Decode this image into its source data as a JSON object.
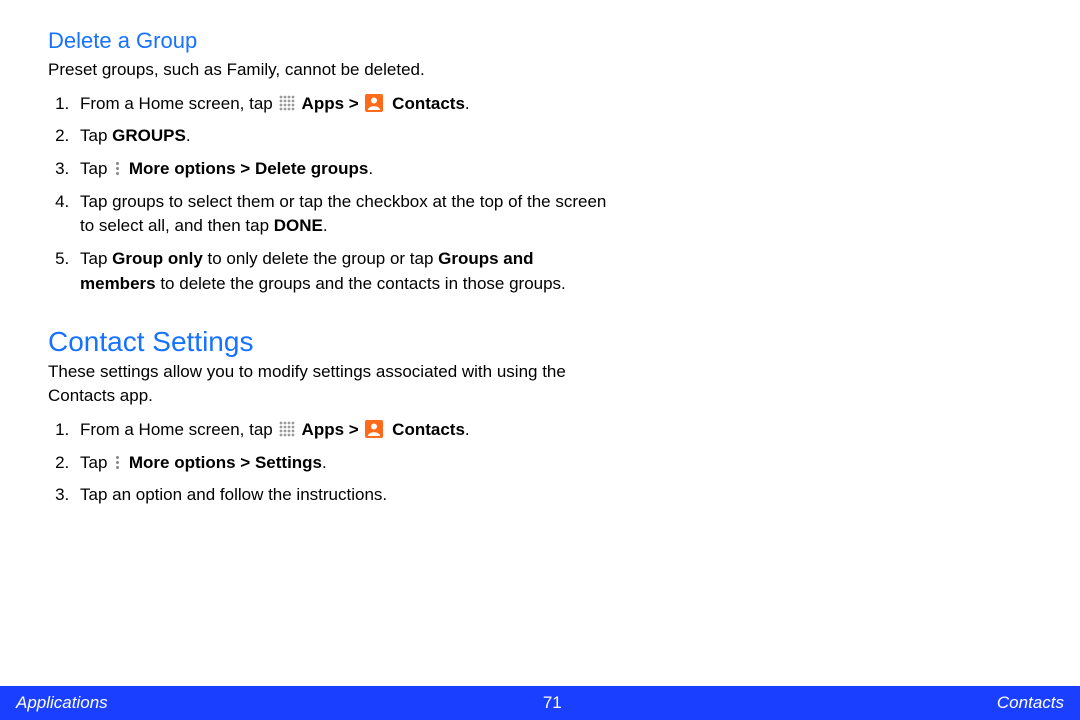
{
  "section1": {
    "heading": "Delete a Group",
    "intro": "Preset groups, such as Family, cannot be deleted.",
    "step1_pre": "From a Home screen, tap ",
    "step1_apps": " Apps > ",
    "step1_contacts": " Contacts",
    "step1_end": ".",
    "step2_pre": "Tap ",
    "step2_bold": "GROUPS",
    "step2_end": ".",
    "step3_pre": "Tap ",
    "step3_bold": " More options > Delete groups",
    "step3_end": ".",
    "step4_pre": "Tap groups to select them or tap the checkbox at the top of the screen to select all, and then tap ",
    "step4_bold": "DONE",
    "step4_end": ".",
    "step5_a": "Tap ",
    "step5_b": "Group only",
    "step5_c": " to only delete the group or tap ",
    "step5_d": "Groups and members",
    "step5_e": " to delete the groups and the contacts in those groups."
  },
  "section2": {
    "heading": "Contact Settings",
    "intro": "These settings allow you to modify settings associated with using the Contacts app.",
    "step1_pre": "From a Home screen, tap ",
    "step1_apps": " Apps > ",
    "step1_contacts": " Contacts",
    "step1_end": ".",
    "step2_pre": "Tap ",
    "step2_bold": " More options > Settings",
    "step2_end": ".",
    "step3": "Tap an option and follow the instructions."
  },
  "footer": {
    "left": "Applications",
    "page": "71",
    "right": "Contacts"
  }
}
